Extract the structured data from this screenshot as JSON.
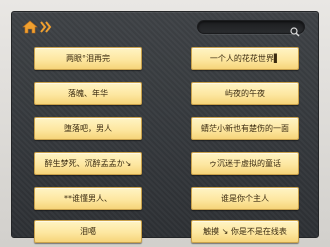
{
  "colors": {
    "panel_bg": "#34373b",
    "button_top": "#fff4c4",
    "button_bottom": "#f6d47a",
    "button_text": "#3a2a10",
    "accent_orange": "#f0a030"
  },
  "topbar": {
    "home_icon": "home-icon",
    "nav_icon": "double-chevron-right-icon",
    "search": {
      "value": "",
      "placeholder": "",
      "icon": "search-icon"
    }
  },
  "grid": {
    "items": [
      {
        "label": "两眼°泪再完"
      },
      {
        "label": "一个人的花花世界▌"
      },
      {
        "label": "落魄、年华"
      },
      {
        "label": "屿夜的午夜"
      },
      {
        "label": "堕落吧，男人"
      },
      {
        "label": "蜻茫小新也有楚伤的一面"
      },
      {
        "label": "醉生梦死、沉醉孟孟か↘"
      },
      {
        "label": "ゥ沉迷于虚拟的童话"
      },
      {
        "label": "**谁懂男人、"
      },
      {
        "label": "谁是你个主人"
      },
      {
        "label": "泪噶"
      },
      {
        "label": "触摸 ↘ 你是不是在线表"
      }
    ]
  }
}
